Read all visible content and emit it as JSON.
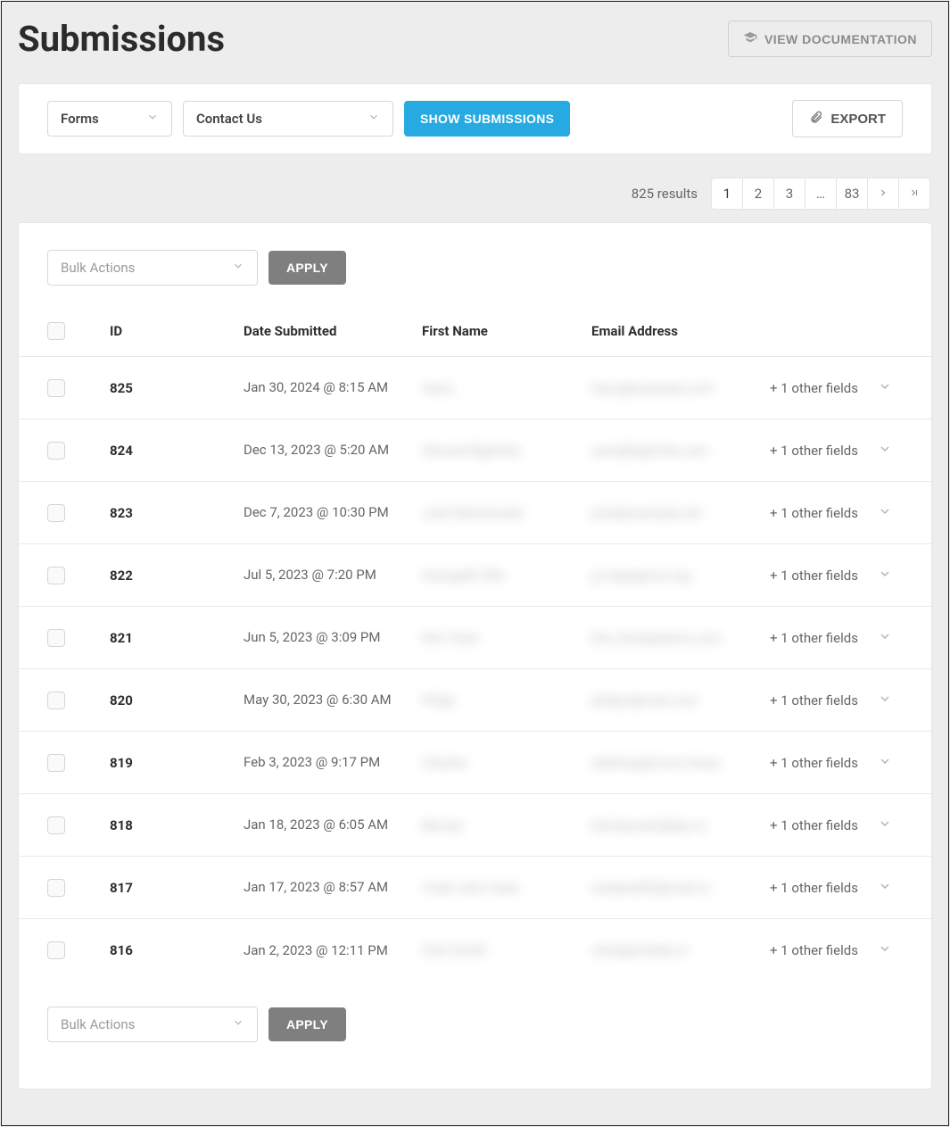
{
  "header": {
    "title": "Submissions",
    "docButton": "VIEW DOCUMENTATION"
  },
  "filter": {
    "formsLabel": "Forms",
    "contactLabel": "Contact Us",
    "showButton": "SHOW SUBMISSIONS",
    "exportButton": "EXPORT"
  },
  "results": {
    "text": "825 results",
    "pages": [
      "1",
      "2",
      "3",
      "…",
      "83"
    ]
  },
  "bulk": {
    "placeholder": "Bulk Actions",
    "apply": "APPLY"
  },
  "columns": {
    "id": "ID",
    "date": "Date Submitted",
    "first": "First Name",
    "email": "Email Address"
  },
  "rows": [
    {
      "id": "825",
      "date": "Jan 30, 2024 @ 8:15 AM",
      "name": "Harry",
      "email": "harry@example.com",
      "other": "+ 1 other fields"
    },
    {
      "id": "824",
      "date": "Dec 13, 2023 @ 5:20 AM",
      "name": "Samuel Bigfonte",
      "email": "sam@bigfonte.com",
      "other": "+ 1 other fields"
    },
    {
      "id": "823",
      "date": "Dec 7, 2023 @ 10:30 PM",
      "name": "Josh MacDonald",
      "email": "josh@example.net",
      "other": "+ 1 other fields"
    },
    {
      "id": "822",
      "date": "Jul 5, 2023 @ 7:20 PM",
      "name": "GeorgeM FRG",
      "email": "g.m@agency.org",
      "other": "+ 1 other fields"
    },
    {
      "id": "821",
      "date": "Jun 5, 2023 @ 3:09 PM",
      "name": "Kim Chan",
      "email": "kim.chan@demo.com",
      "other": "+ 1 other fields"
    },
    {
      "id": "820",
      "date": "May 30, 2023 @ 6:30 AM",
      "name": "Philip",
      "email": "philipc@mail.com",
      "other": "+ 1 other fields"
    },
    {
      "id": "819",
      "date": "Feb 3, 2023 @ 9:17 PM",
      "name": "Charles",
      "email": "hellohey@more.those",
      "other": "+ 1 other fields"
    },
    {
      "id": "818",
      "date": "Jan 18, 2023 @ 6:05 AM",
      "name": "Barney",
      "email": "barneyuser@big.co",
      "other": "+ 1 other fields"
    },
    {
      "id": "817",
      "date": "Jan 17, 2023 @ 8:57 AM",
      "name": "Todd John Hank",
      "email": "strakee805@mail.io",
      "other": "+ 1 other fields"
    },
    {
      "id": "816",
      "date": "Jan 2, 2023 @ 12:11 PM",
      "name": "Clint Smith",
      "email": "clint@profake.io",
      "other": "+ 1 other fields"
    }
  ]
}
